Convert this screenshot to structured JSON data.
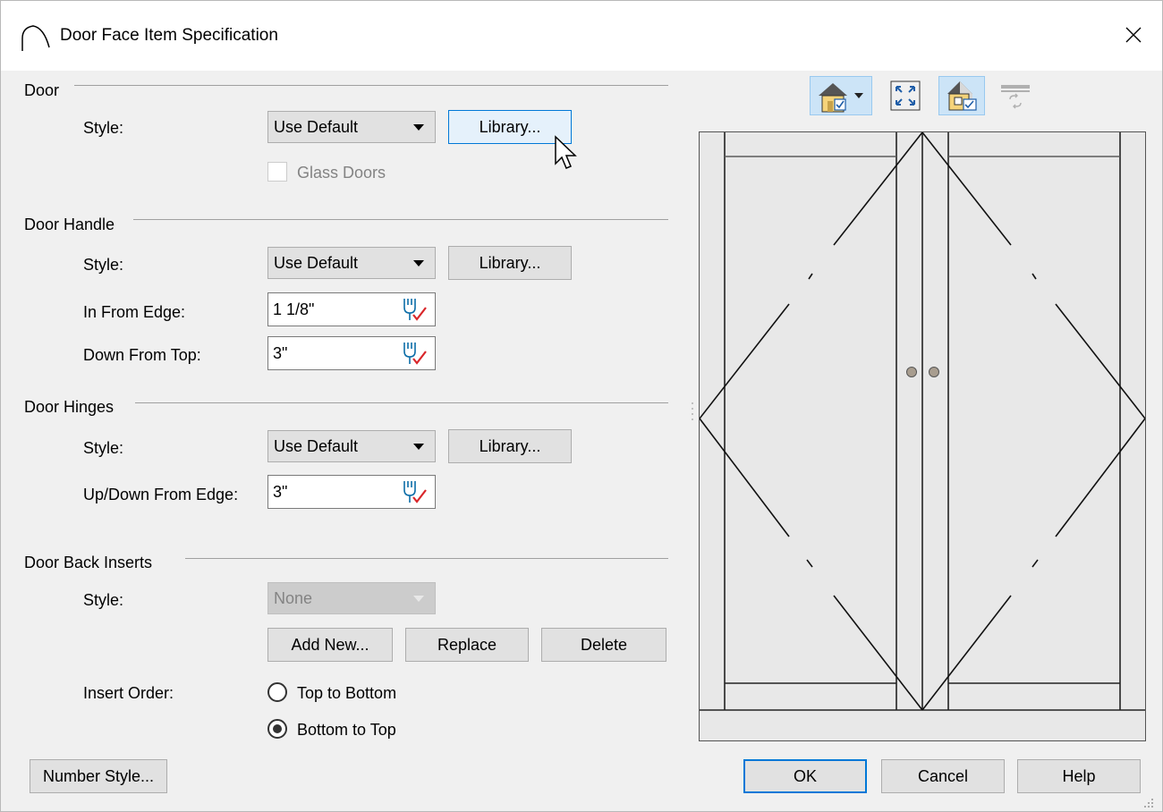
{
  "window": {
    "title": "Door Face Item Specification",
    "close_label": "✕"
  },
  "door": {
    "heading": "Door",
    "style_label": "Style:",
    "style_value": "Use Default",
    "library_label": "Library...",
    "glass_doors_label": "Glass Doors",
    "glass_doors_checked": false
  },
  "door_handle": {
    "heading": "Door Handle",
    "style_label": "Style:",
    "style_value": "Use Default",
    "library_label": "Library...",
    "in_from_edge_label": "In From Edge:",
    "in_from_edge_value": "1 1/8\"",
    "down_from_top_label": "Down From Top:",
    "down_from_top_value": "3\""
  },
  "door_hinges": {
    "heading": "Door Hinges",
    "style_label": "Style:",
    "style_value": "Use Default",
    "library_label": "Library...",
    "up_down_label": "Up/Down From Edge:",
    "up_down_value": "3\""
  },
  "door_back_inserts": {
    "heading": "Door Back Inserts",
    "style_label": "Style:",
    "style_value": "None",
    "add_new_label": "Add New...",
    "replace_label": "Replace",
    "delete_label": "Delete",
    "insert_order_label": "Insert Order:",
    "options": [
      "Top to Bottom",
      "Bottom to Top"
    ],
    "selected_option": "Bottom to Top"
  },
  "footer": {
    "number_style_label": "Number Style...",
    "ok_label": "OK",
    "cancel_label": "Cancel",
    "help_label": "Help"
  },
  "preview_toolbar": {
    "icons": [
      "3d-view-icon",
      "fill-window-icon",
      "camera-view-icon",
      "refresh-preview-icon"
    ]
  },
  "colors": {
    "accent": "#0078d7",
    "dialog_bg": "#f0f0f0",
    "preview_bg": "#e8e8e8",
    "handle_knob": "#a89d8f"
  }
}
